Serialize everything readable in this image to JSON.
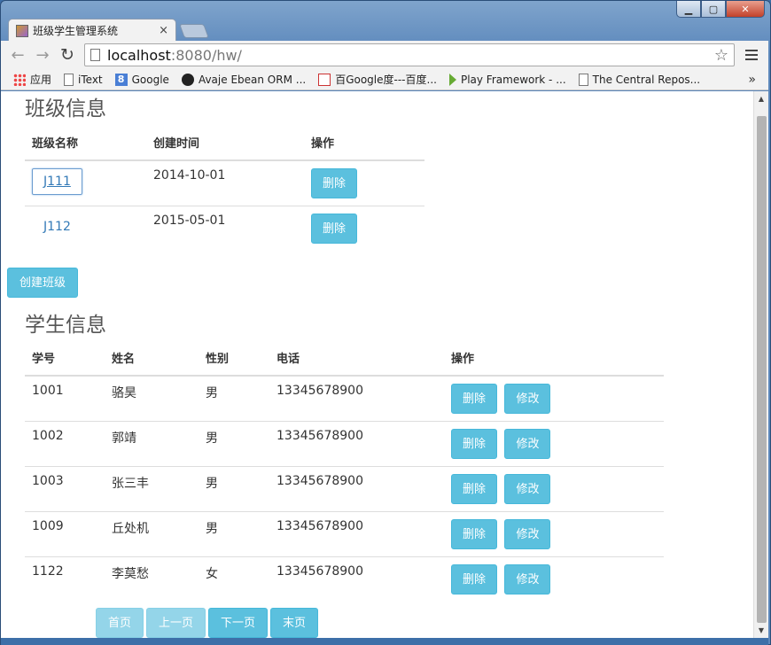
{
  "window": {
    "min_glyph": "▁",
    "max_glyph": "▢",
    "close_glyph": "✕"
  },
  "tab": {
    "title": "班级学生管理系统",
    "close_glyph": "×"
  },
  "toolbar": {
    "back_glyph": "←",
    "forward_glyph": "→",
    "reload_glyph": "↻",
    "url_host": "localhost",
    "url_rest": ":8080/hw/",
    "star_glyph": "☆"
  },
  "bookmarks": {
    "items": [
      {
        "label": "应用",
        "icon": "apps-icon"
      },
      {
        "label": "iText",
        "icon": "page-icon"
      },
      {
        "label": "Google",
        "icon": "google-icon"
      },
      {
        "label": "Avaje Ebean ORM ...",
        "icon": "avaje-icon"
      },
      {
        "label": "百Google度---百度...",
        "icon": "baidu-icon"
      },
      {
        "label": "Play Framework - ...",
        "icon": "play-icon"
      },
      {
        "label": "The Central Repos...",
        "icon": "page-icon"
      }
    ],
    "more": "»"
  },
  "classes": {
    "heading": "班级信息",
    "headers": [
      "班级名称",
      "创建时间",
      "操作"
    ],
    "rows": [
      {
        "name": "J111",
        "created": "2014-10-01",
        "delete": "删除"
      },
      {
        "name": "J112",
        "created": "2015-05-01",
        "delete": "删除"
      }
    ],
    "create_button": "创建班级"
  },
  "students": {
    "heading": "学生信息",
    "headers": [
      "学号",
      "姓名",
      "性别",
      "电话",
      "操作"
    ],
    "rows": [
      {
        "id": "1001",
        "name": "骆昊",
        "gender": "男",
        "phone": "13345678900",
        "delete": "删除",
        "edit": "修改"
      },
      {
        "id": "1002",
        "name": "郭靖",
        "gender": "男",
        "phone": "13345678900",
        "delete": "删除",
        "edit": "修改"
      },
      {
        "id": "1003",
        "name": "张三丰",
        "gender": "男",
        "phone": "13345678900",
        "delete": "删除",
        "edit": "修改"
      },
      {
        "id": "1009",
        "name": "丘处机",
        "gender": "男",
        "phone": "13345678900",
        "delete": "删除",
        "edit": "修改"
      },
      {
        "id": "1122",
        "name": "李莫愁",
        "gender": "女",
        "phone": "13345678900",
        "delete": "删除",
        "edit": "修改"
      }
    ]
  },
  "pager": {
    "first": "首页",
    "prev": "上一页",
    "next": "下一页",
    "last": "末页"
  },
  "colors": {
    "button": "#5bc0de",
    "link": "#337ab7",
    "heading": "#555555"
  }
}
